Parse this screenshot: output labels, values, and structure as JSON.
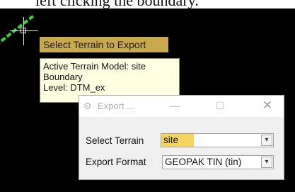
{
  "document": {
    "partial_text": "left clicking the boundary."
  },
  "prompt": {
    "label": "Select Terrain to Export"
  },
  "info_tip": {
    "lines": [
      "Active Terrain Model: site",
      "Boundary",
      "Level: DTM_ex"
    ]
  },
  "dialog": {
    "title": "Export ...",
    "icons": {
      "app": "gear-icon",
      "minimize": "minimize-icon",
      "maximize": "maximize-icon",
      "close": "close-icon"
    },
    "fields": {
      "select_terrain": {
        "label": "Select Terrain",
        "value": "site"
      },
      "export_format": {
        "label": "Export Format",
        "value": "GEOPAK TIN (tin)"
      }
    }
  },
  "colors": {
    "viewport_bg": "#000000",
    "boundary": "#3bd13b",
    "prompt_bg": "#c9a94d",
    "tooltip_bg": "#ffffe1",
    "highlight": "#f5d560"
  }
}
